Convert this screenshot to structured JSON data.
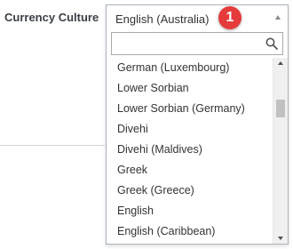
{
  "field": {
    "label": "Currency Culture"
  },
  "dropdown": {
    "selected": "English (Australia)",
    "badge": "1",
    "search_placeholder": "",
    "options": [
      "German (Luxembourg)",
      "Lower Sorbian",
      "Lower Sorbian (Germany)",
      "Divehi",
      "Divehi (Maldives)",
      "Greek",
      "Greek (Greece)",
      "English",
      "English (Caribbean)"
    ]
  },
  "icons": {
    "search": "search-icon",
    "caret": "caret-up-icon",
    "scroll_up": "chevron-up-icon",
    "scroll_down": "chevron-down-icon"
  },
  "colors": {
    "badge": "#e53b3b",
    "border": "#aab3bd",
    "label": "#3a3f45"
  }
}
